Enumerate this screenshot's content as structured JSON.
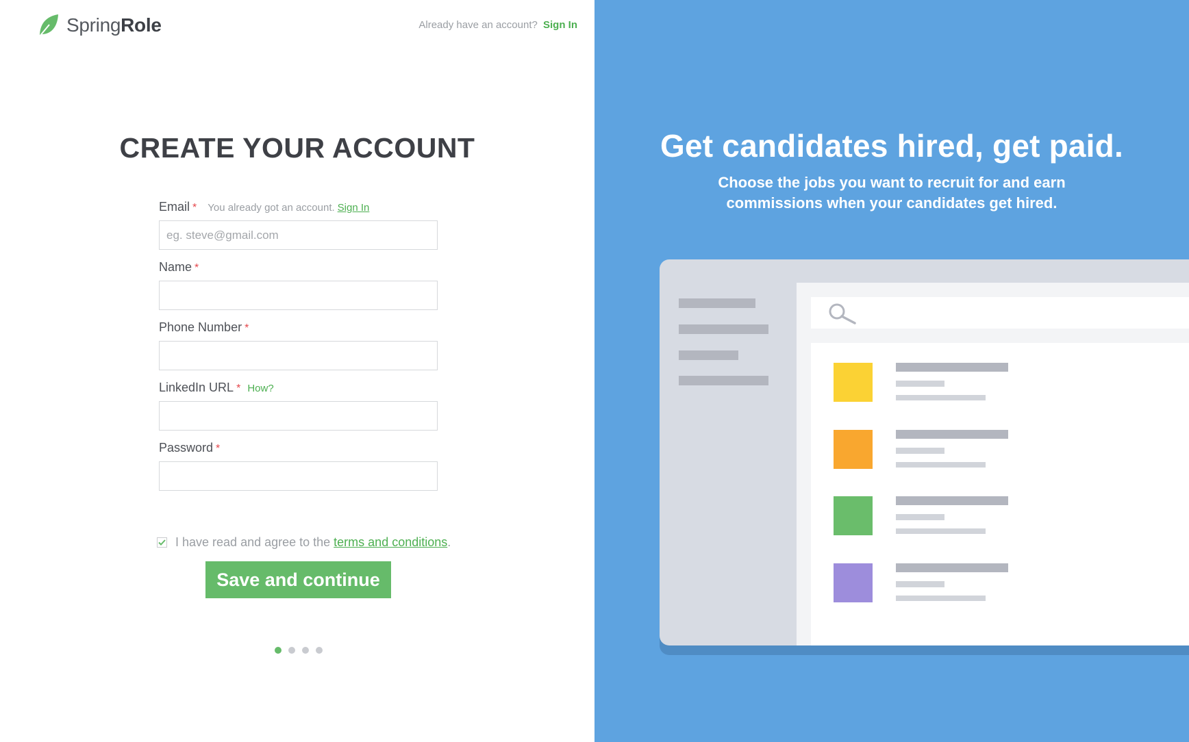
{
  "brand": {
    "name_light": "Spring",
    "name_bold": "Role",
    "logo_icon": "leaf-icon",
    "accent_color": "#66bb6a"
  },
  "header": {
    "prompt": "Already have an account?",
    "signin_label": "Sign In"
  },
  "form": {
    "title": "CREATE YOUR ACCOUNT",
    "required_mark": "*",
    "email": {
      "label": "Email",
      "hint": "You already got an account.",
      "hint_link": "Sign In",
      "placeholder": "eg. steve@gmail.com",
      "value": ""
    },
    "name": {
      "label": "Name",
      "value": ""
    },
    "phone": {
      "label": "Phone Number",
      "value": ""
    },
    "linkedin": {
      "label": "LinkedIn URL",
      "help_link": "How?",
      "value": ""
    },
    "password": {
      "label": "Password",
      "value": ""
    },
    "agree": {
      "checked": true,
      "text": "I have read and agree to the",
      "link": "terms and conditions",
      "end": "."
    },
    "submit_label": "Save and continue"
  },
  "pager": {
    "total": 4,
    "current": 1
  },
  "promo": {
    "title": "Get candidates hired, get paid.",
    "subtitle_line1": "Choose the jobs you want to recruit for and earn",
    "subtitle_line2": "commissions when your candidates get hired.",
    "background_color": "#5ea3e0",
    "illustration_item_colors": [
      "#fbd234",
      "#f9a72f",
      "#6abd6b",
      "#9d8ddc"
    ]
  }
}
